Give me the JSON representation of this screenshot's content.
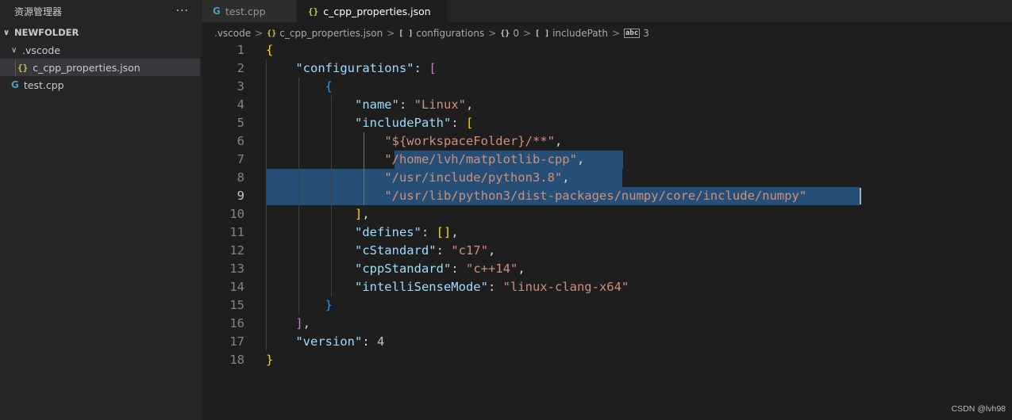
{
  "sidebar": {
    "title": "资源管理器",
    "more": "···",
    "root_folder": "NEWFOLDER",
    "items": [
      {
        "label": ".vscode",
        "chevron": "∨"
      },
      {
        "label": "c_cpp_properties.json",
        "icon": "{}"
      },
      {
        "label": "test.cpp",
        "icon": "G"
      }
    ]
  },
  "tabs": [
    {
      "label": "test.cpp",
      "icon": "G"
    },
    {
      "label": "c_cpp_properties.json",
      "icon": "{}"
    }
  ],
  "breadcrumb": {
    "folder": ".vscode",
    "file_icon": "{}",
    "file": "c_cpp_properties.json",
    "arr_icon": "[ ]",
    "configurations": "configurations",
    "obj_icon": "{}",
    "index": "0",
    "include_icon": "[ ]",
    "include": "includePath",
    "str_icon": "abc",
    "str_index": "3",
    "separator": ">"
  },
  "editor": {
    "line_numbers": [
      "1",
      "2",
      "3",
      "4",
      "5",
      "6",
      "7",
      "8",
      "9",
      "10",
      "11",
      "12",
      "13",
      "14",
      "15",
      "16",
      "17",
      "18"
    ],
    "code": {
      "l1": "{",
      "l2_key": "\"configurations\"",
      "l2_colon": ": ",
      "l2_br": "[",
      "l3": "{",
      "l4_key": "\"name\"",
      "l4_colon": ": ",
      "l4_val": "\"Linux\"",
      "l4_comma": ",",
      "l5_key": "\"includePath\"",
      "l5_colon": ": ",
      "l5_br": "[",
      "l6_val": "\"${workspaceFolder}/**\"",
      "l6_comma": ",",
      "l7_val": "\"/home/lvh/matplotlib-cpp\"",
      "l7_comma": ",",
      "l8_val": "\"/usr/include/python3.8\"",
      "l8_comma": ",",
      "l9_val": "\"/usr/lib/python3/dist-packages/numpy/core/include/numpy\"",
      "l10_br": "]",
      "l10_comma": ",",
      "l11_key": "\"defines\"",
      "l11_colon": ": ",
      "l11_br": "[]",
      "l11_comma": ",",
      "l12_key": "\"cStandard\"",
      "l12_colon": ": ",
      "l12_val": "\"c17\"",
      "l12_comma": ",",
      "l13_key": "\"cppStandard\"",
      "l13_colon": ": ",
      "l13_val": "\"c++14\"",
      "l13_comma": ",",
      "l14_key": "\"intelliSenseMode\"",
      "l14_colon": ": ",
      "l14_val": "\"linux-clang-x64\"",
      "l15": "}",
      "l16_br": "]",
      "l16_comma": ",",
      "l17_key": "\"version\"",
      "l17_colon": ": ",
      "l17_val": "4",
      "l18": "}"
    }
  },
  "watermark": "CSDN @lvh98",
  "colors": {
    "background": "#1e1e1e",
    "sidebar": "#252526",
    "selection": "#264f78",
    "key": "#9cdcfe",
    "string": "#ce9178",
    "number": "#b5cea8"
  }
}
